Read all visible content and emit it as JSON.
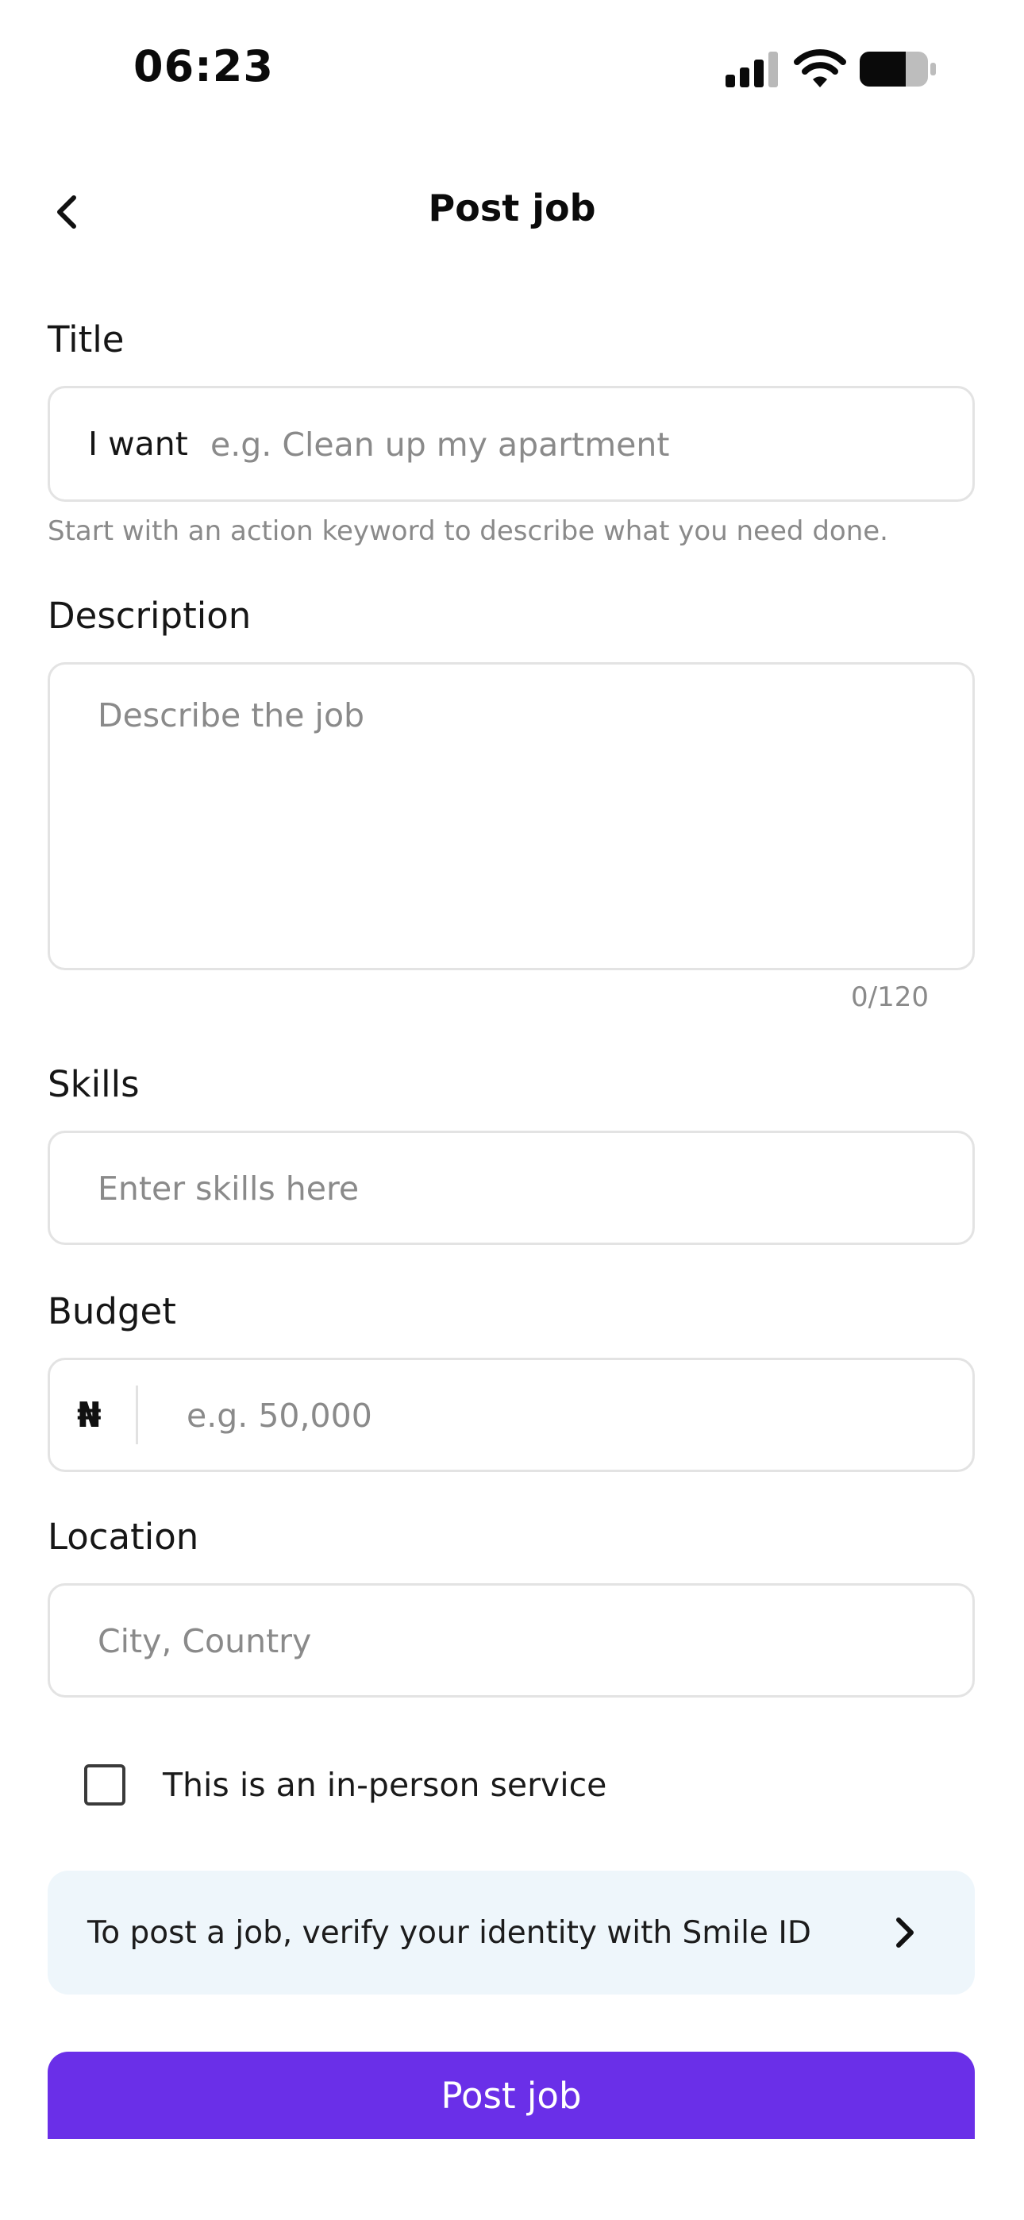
{
  "status_bar": {
    "time": "06:23"
  },
  "header": {
    "title": "Post job",
    "back_icon": "chevron-left-icon"
  },
  "form": {
    "title": {
      "label": "Title",
      "prefix": "I want",
      "placeholder": "e.g. Clean up my apartment",
      "value": "",
      "helper": "Start with an action keyword to describe what you need done."
    },
    "description": {
      "label": "Description",
      "placeholder": "Describe the job",
      "value": "",
      "counter": "0/120"
    },
    "skills": {
      "label": "Skills",
      "placeholder": "Enter skills here",
      "value": ""
    },
    "budget": {
      "label": "Budget",
      "currency": "₦",
      "placeholder": "e.g. 50,000",
      "value": ""
    },
    "location": {
      "label": "Location",
      "placeholder": "City, Country",
      "value": ""
    },
    "in_person": {
      "label": "This is an in-person service",
      "checked": false
    }
  },
  "verify_banner": {
    "text": "To post a job, verify your identity with Smile ID",
    "icon": "chevron-right-icon"
  },
  "submit": {
    "label": "Post job"
  },
  "colors": {
    "primary": "#6a2fe8",
    "banner_bg": "#eef6fb",
    "border": "#e3e3e3",
    "placeholder": "#8a8a8a"
  }
}
